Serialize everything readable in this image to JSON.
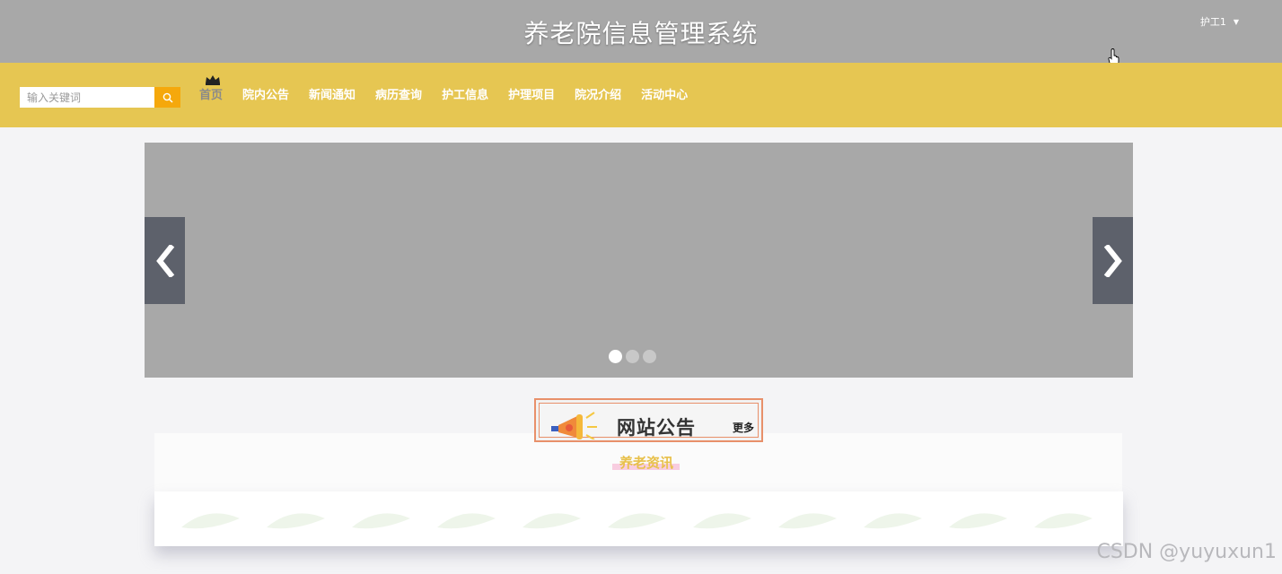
{
  "header": {
    "title": "养老院信息管理系统",
    "user": "护工1"
  },
  "search": {
    "placeholder": "输入关键词",
    "value": ""
  },
  "nav": {
    "items": [
      {
        "label": "首页"
      },
      {
        "label": "院内公告"
      },
      {
        "label": "新闻通知"
      },
      {
        "label": "病历查询"
      },
      {
        "label": "护工信息"
      },
      {
        "label": "护理项目"
      },
      {
        "label": "院况介绍"
      },
      {
        "label": "活动中心"
      }
    ]
  },
  "carousel": {
    "slide_count": 3,
    "active_index": 0
  },
  "notice": {
    "title": "网站公告",
    "more": "更多"
  },
  "section": {
    "heading": "养老资讯"
  },
  "watermark": "CSDN @yuyuxun1",
  "colors": {
    "topbar": "#a8a8a8",
    "navbar": "#e6c652",
    "search_button": "#f5a80c",
    "carousel_bg": "#a8a8a8",
    "arrow_bg": "#5d616b",
    "accent_heading": "#e8c04a"
  }
}
